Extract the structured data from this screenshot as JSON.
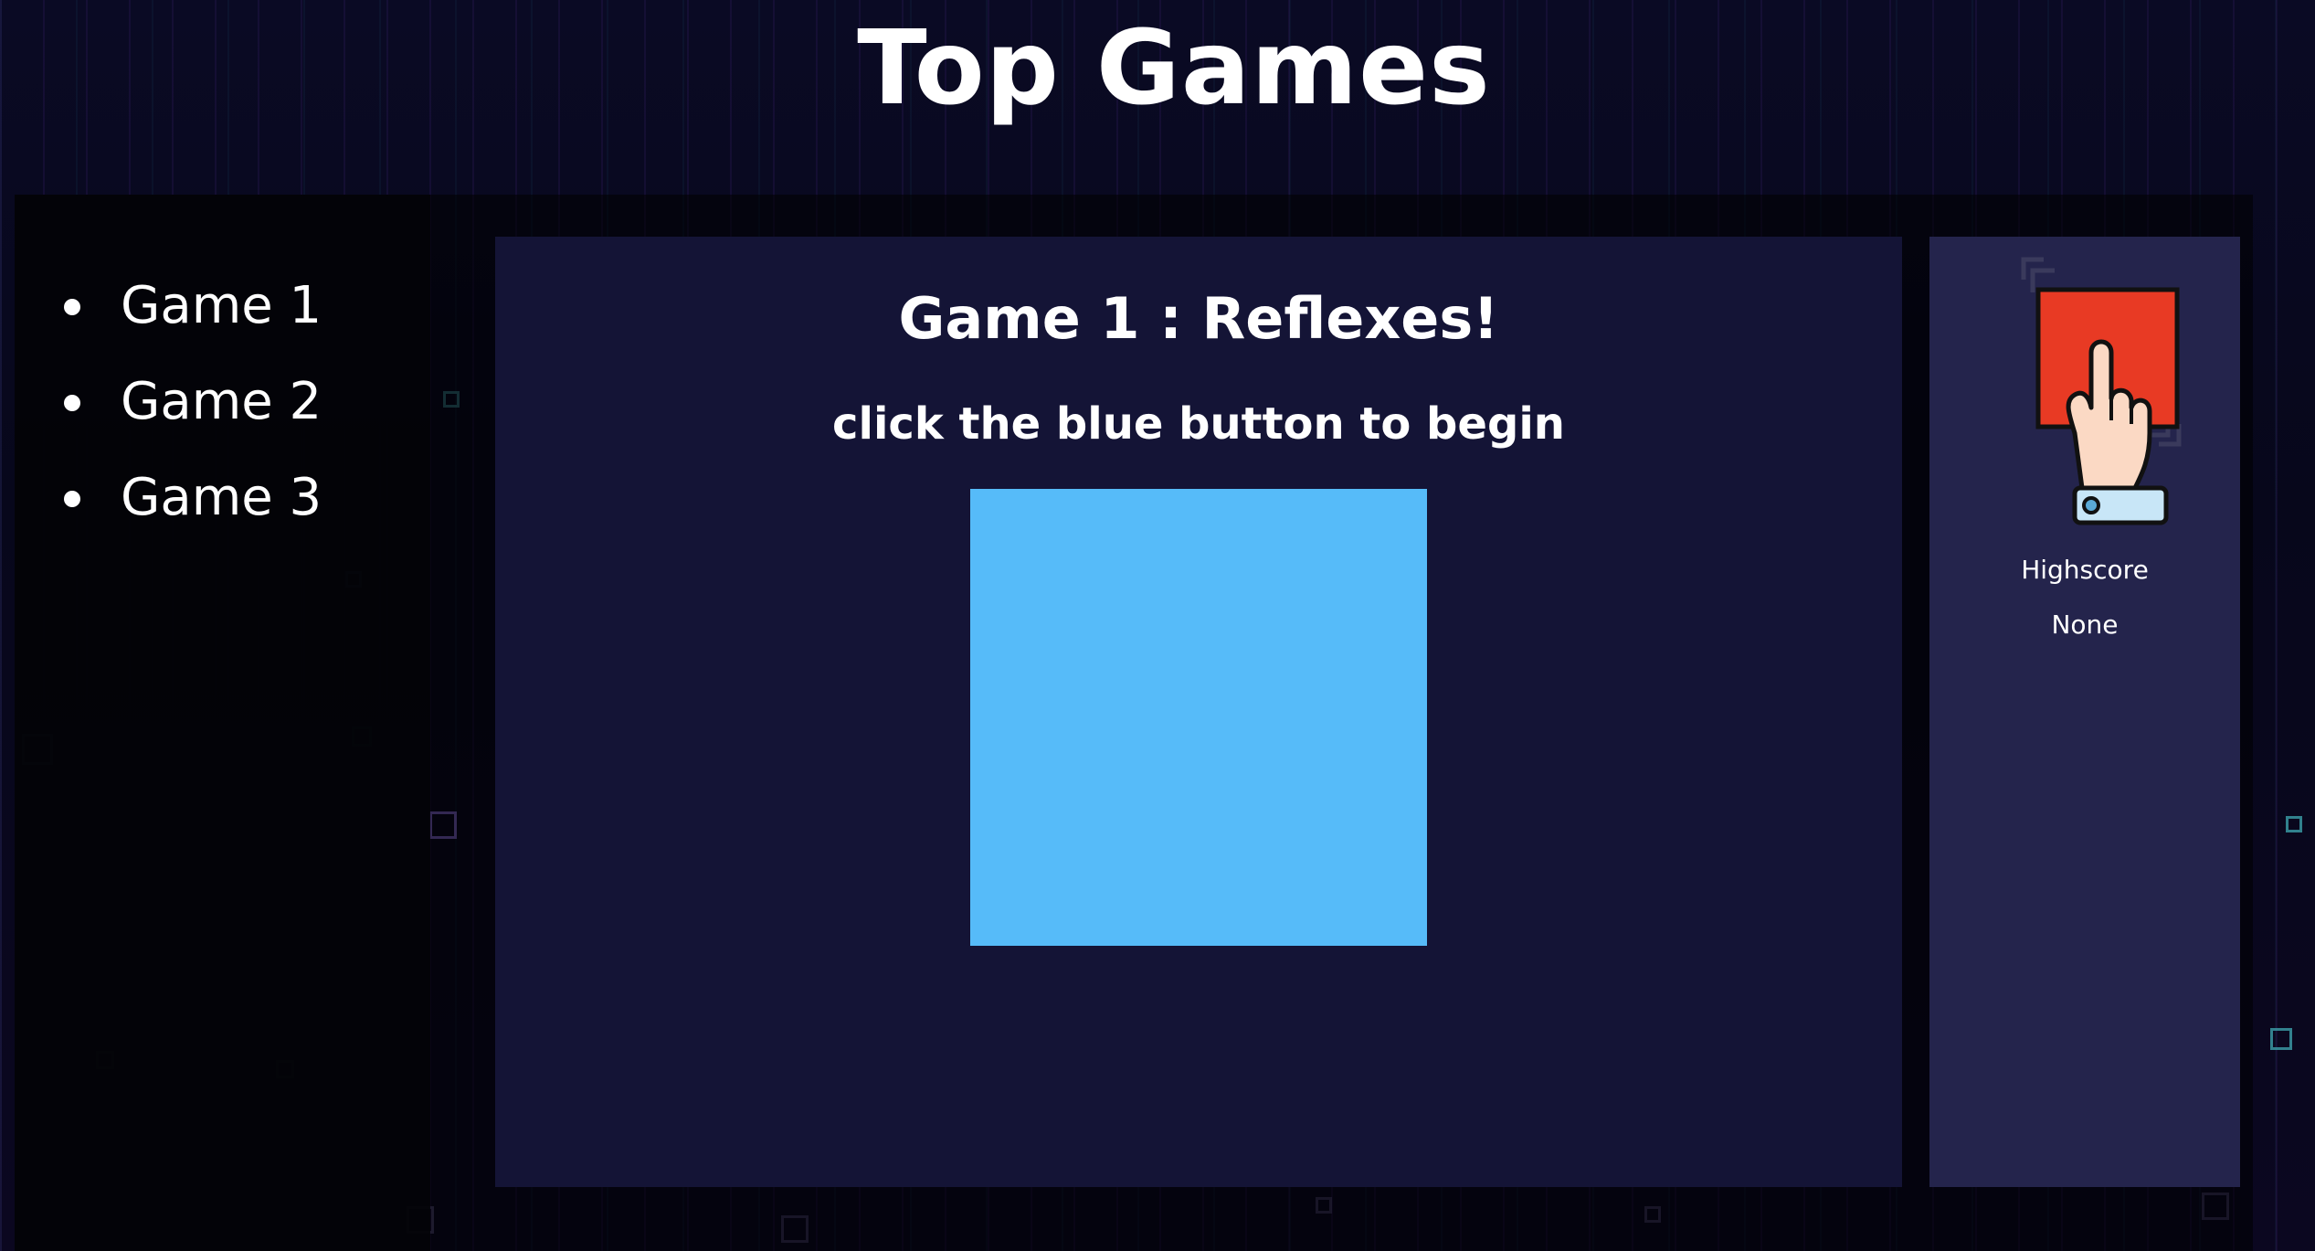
{
  "header": {
    "title": "Top Games"
  },
  "nav": {
    "items": [
      {
        "label": "Game 1"
      },
      {
        "label": "Game 2"
      },
      {
        "label": "Game 3"
      }
    ]
  },
  "game": {
    "title": "Game 1 : Reflexes!",
    "instruction": "click the blue button to begin",
    "button_color": "#56bbf9"
  },
  "scoreboard": {
    "icon": "hand-pressing-red-button-icon",
    "highscore_label": "Highscore",
    "highscore_value": "None"
  },
  "colors": {
    "page_background": "#06061a",
    "game_panel": "#141436",
    "score_panel": "#24244c",
    "icon_red": "#e83a24",
    "icon_cuff": "#c8e6f7"
  }
}
